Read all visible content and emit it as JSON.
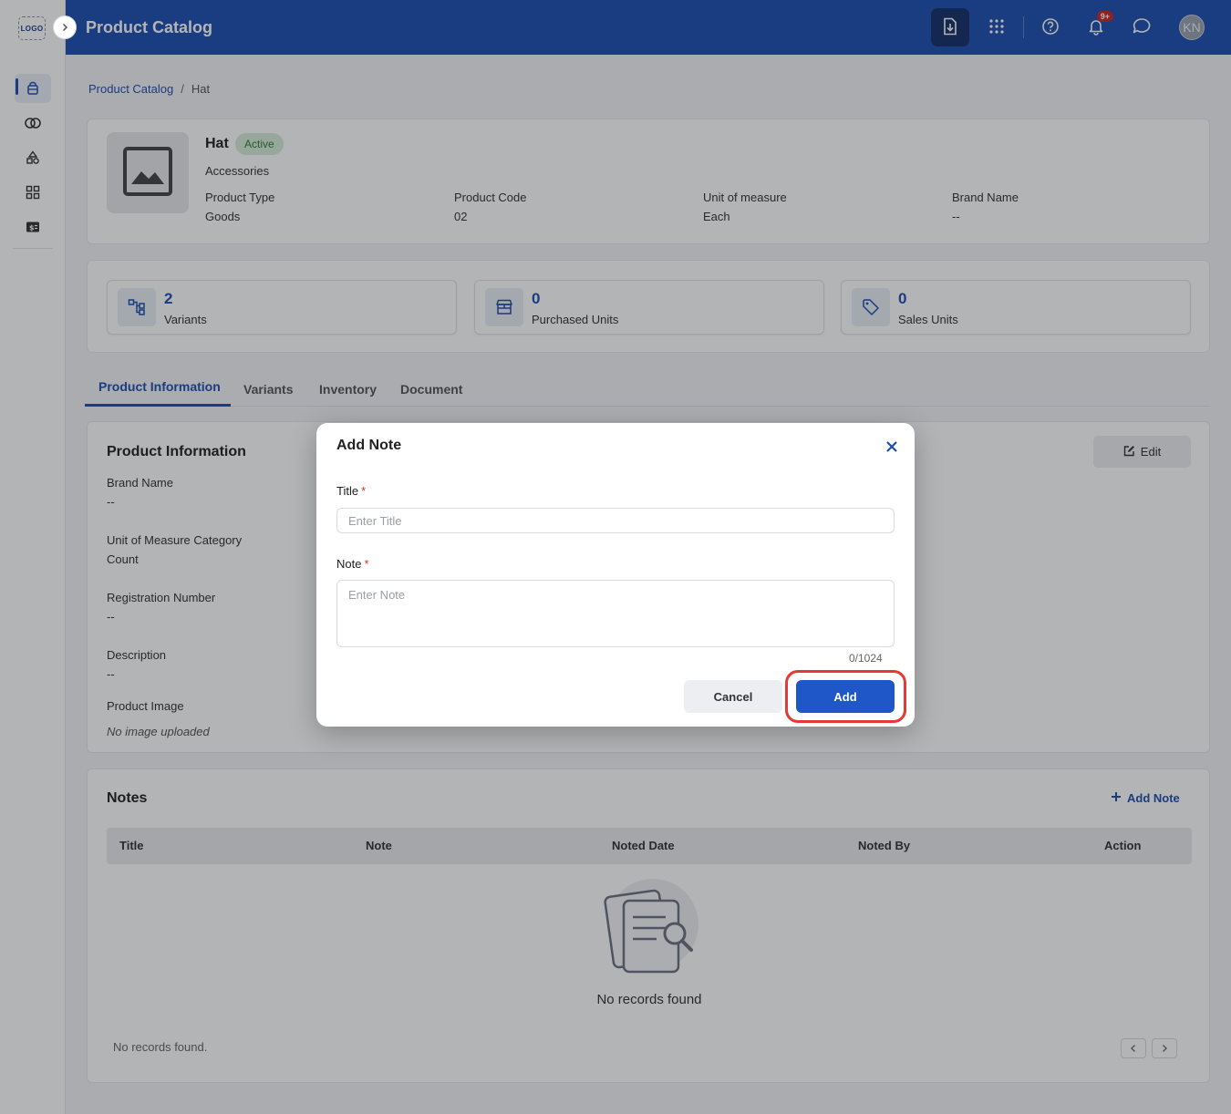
{
  "app": {
    "logo_text": "LOGO",
    "header_title": "Product Catalog",
    "notification_badge": "9+",
    "avatar_initials": "KN"
  },
  "breadcrumb": {
    "root": "Product Catalog",
    "current": "Hat"
  },
  "product": {
    "name": "Hat",
    "status": "Active",
    "category": "Accessories",
    "meta": [
      {
        "label": "Product Type",
        "value": "Goods"
      },
      {
        "label": "Product Code",
        "value": "02"
      },
      {
        "label": "Unit of measure",
        "value": "Each"
      },
      {
        "label": "Brand Name",
        "value": "--"
      }
    ]
  },
  "stats": [
    {
      "value": "2",
      "label": "Variants",
      "icon": "hierarchy-icon"
    },
    {
      "value": "0",
      "label": "Purchased Units",
      "icon": "store-icon"
    },
    {
      "value": "0",
      "label": "Sales Units",
      "icon": "tag-icon"
    }
  ],
  "tabs": [
    "Product Information",
    "Variants",
    "Inventory",
    "Document"
  ],
  "info": {
    "title": "Product Information",
    "edit_label": "Edit",
    "fields": [
      {
        "label": "Brand Name",
        "value": "--"
      },
      {
        "label": "Unit of Measure Category",
        "value": "Count"
      },
      {
        "label": "Registration Number",
        "value": "--"
      },
      {
        "label": "Description",
        "value": "--"
      },
      {
        "label": "Product Image",
        "value": "No image uploaded"
      }
    ]
  },
  "notes": {
    "title": "Notes",
    "add_label": "Add Note",
    "columns": [
      "Title",
      "Note",
      "Noted Date",
      "Noted By",
      "Action"
    ],
    "empty_text": "No records found",
    "footer_text": "No records found."
  },
  "modal": {
    "title": "Add Note",
    "title_label": "Title",
    "title_placeholder": "Enter Title",
    "note_label": "Note",
    "note_placeholder": "Enter Note",
    "char_count": "0/1024",
    "cancel_label": "Cancel",
    "add_label": "Add",
    "required_mark": "*"
  },
  "colors": {
    "primary": "#1e4fb0",
    "button_blue": "#1f56c8",
    "highlight": "#e53935",
    "status_green": "#2e7d32"
  }
}
